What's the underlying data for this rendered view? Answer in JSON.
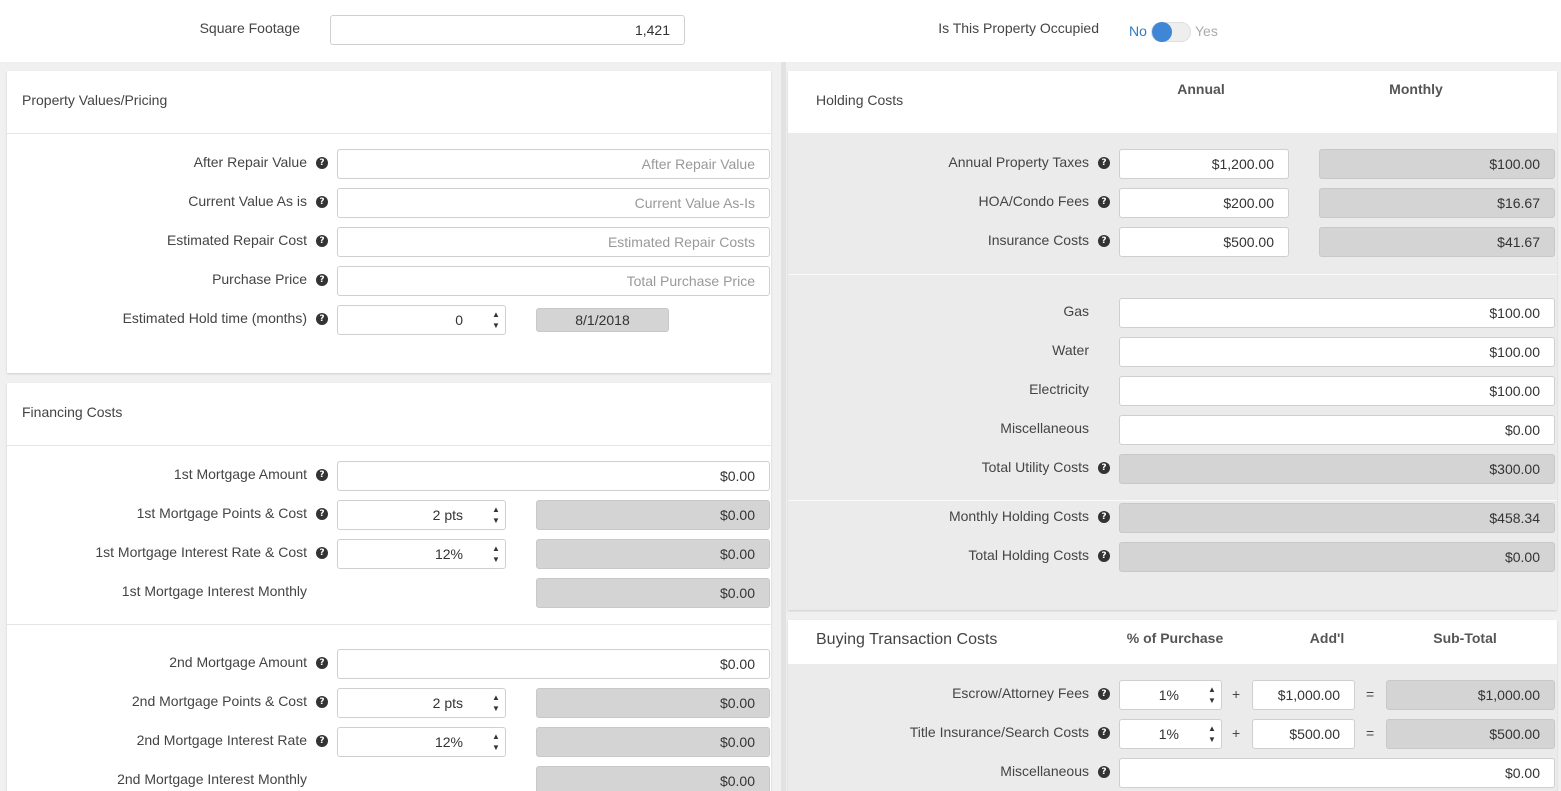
{
  "top": {
    "square_footage_label": "Square Footage",
    "square_footage_value": "1,421",
    "occupied_label": "Is This Property Occupied",
    "toggle_no": "No",
    "toggle_yes": "Yes"
  },
  "property_values": {
    "title": "Property Values/Pricing",
    "after_repair_label": "After Repair Value",
    "after_repair_placeholder": "After Repair Value",
    "current_value_label": "Current Value As is",
    "current_value_placeholder": "Current Value As-Is",
    "repair_cost_label": "Estimated Repair Cost",
    "repair_cost_placeholder": "Estimated Repair Costs",
    "purchase_price_label": "Purchase Price",
    "purchase_price_placeholder": "Total Purchase Price",
    "hold_time_label": "Estimated Hold time (months)",
    "hold_time_value": "0",
    "hold_date": "8/1/2018"
  },
  "financing": {
    "title": "Financing Costs",
    "m1_amount_label": "1st Mortgage Amount",
    "m1_amount_value": "$0.00",
    "m1_points_label": "1st Mortgage Points & Cost",
    "m1_points_value": "2 pts",
    "m1_points_cost": "$0.00",
    "m1_rate_label": "1st Mortgage Interest Rate & Cost",
    "m1_rate_value": "12%",
    "m1_rate_cost": "$0.00",
    "m1_monthly_label": "1st Mortgage Interest Monthly",
    "m1_monthly_value": "$0.00",
    "m2_amount_label": "2nd Mortgage Amount",
    "m2_amount_value": "$0.00",
    "m2_points_label": "2nd Mortgage Points & Cost",
    "m2_points_value": "2 pts",
    "m2_points_cost": "$0.00",
    "m2_rate_label": "2nd Mortgage Interest Rate",
    "m2_rate_value": "12%",
    "m2_rate_cost": "$0.00",
    "m2_monthly_label": "2nd Mortgage Interest Monthly",
    "m2_monthly_value": "$0.00"
  },
  "holding": {
    "title": "Holding Costs",
    "col_annual": "Annual",
    "col_monthly": "Monthly",
    "taxes_label": "Annual Property Taxes",
    "taxes_annual": "$1,200.00",
    "taxes_monthly": "$100.00",
    "hoa_label": "HOA/Condo Fees",
    "hoa_annual": "$200.00",
    "hoa_monthly": "$16.67",
    "insurance_label": "Insurance Costs",
    "insurance_annual": "$500.00",
    "insurance_monthly": "$41.67",
    "gas_label": "Gas",
    "gas_value": "$100.00",
    "water_label": "Water",
    "water_value": "$100.00",
    "electricity_label": "Electricity",
    "electricity_value": "$100.00",
    "misc_label": "Miscellaneous",
    "misc_value": "$0.00",
    "total_utility_label": "Total Utility Costs",
    "total_utility_value": "$300.00",
    "monthly_holding_label": "Monthly Holding Costs",
    "monthly_holding_value": "$458.34",
    "total_holding_label": "Total Holding Costs",
    "total_holding_value": "$0.00"
  },
  "buying": {
    "title": "Buying Transaction Costs",
    "col_pct": "% of Purchase",
    "col_addl": "Add'l",
    "col_subtotal": "Sub-Total",
    "escrow_label": "Escrow/Attorney Fees",
    "escrow_pct": "1%",
    "escrow_addl": "$1,000.00",
    "escrow_subtotal": "$1,000.00",
    "title_label": "Title Insurance/Search Costs",
    "title_pct": "1%",
    "title_addl": "$500.00",
    "title_subtotal": "$500.00",
    "misc_label": "Miscellaneous",
    "misc_value": "$0.00",
    "op_plus": "+",
    "op_eq": "="
  }
}
